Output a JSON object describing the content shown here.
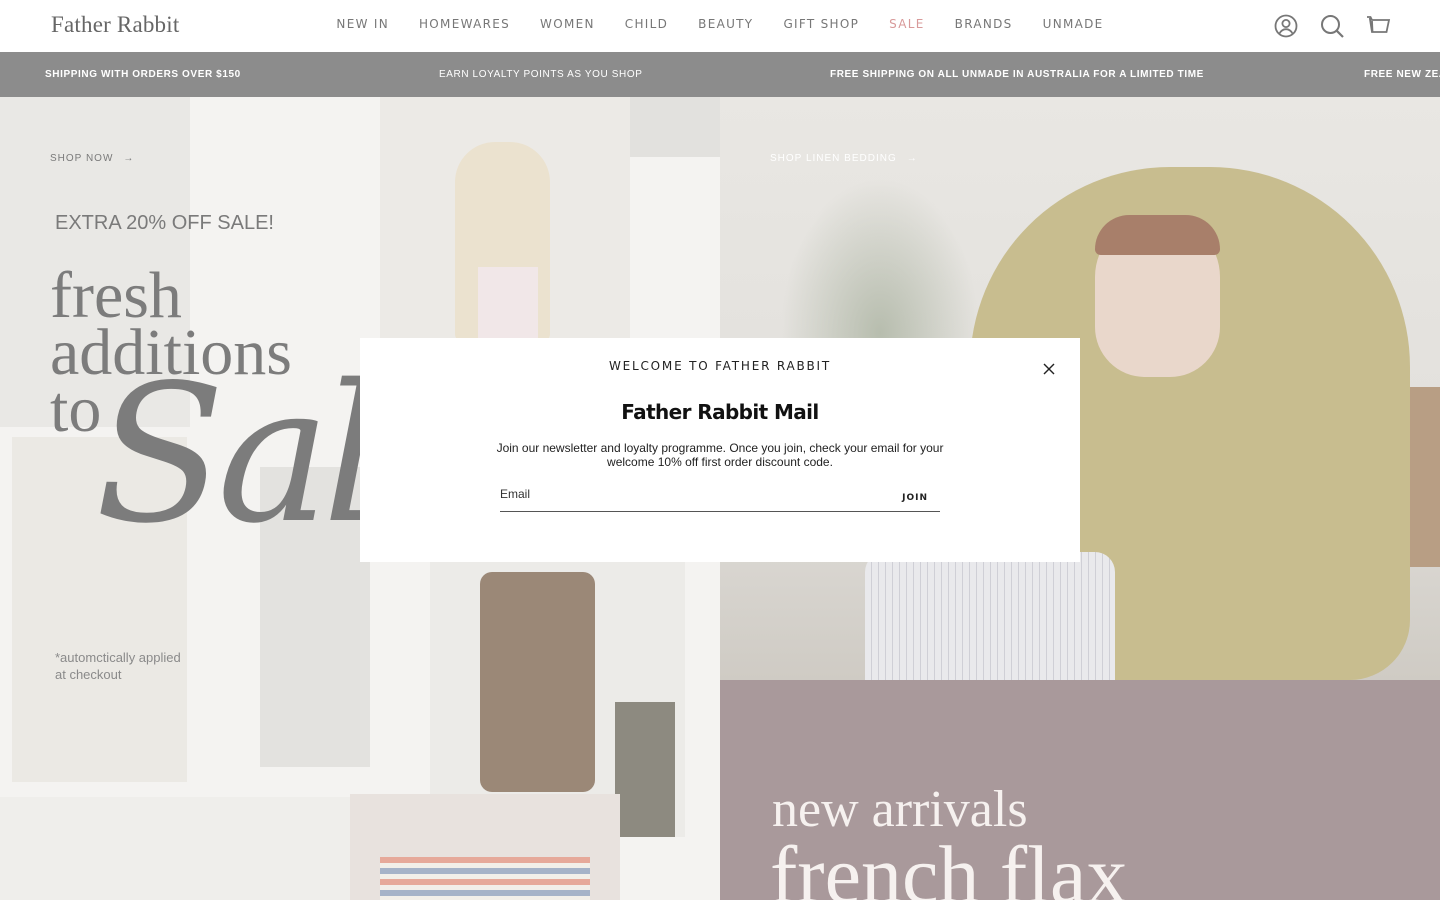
{
  "header": {
    "logo": "Father Rabbit",
    "nav": [
      "NEW IN",
      "HOMEWARES",
      "WOMEN",
      "CHILD",
      "BEAUTY",
      "GIFT SHOP",
      "SALE",
      "BRANDS",
      "UNMADE"
    ],
    "icons": [
      "account-icon",
      "search-icon",
      "cart-icon"
    ]
  },
  "announcements": [
    "SHIPPING WITH ORDERS OVER $150",
    "EARN LOYALTY POINTS AS YOU SHOP",
    "FREE SHIPPING ON ALL UNMADE IN AUSTRALIA FOR A LIMITED TIME",
    "FREE NEW ZEA"
  ],
  "hero_left": {
    "shop_link": "SHOP NOW",
    "extra": "EXTRA 20% OFF SALE!",
    "headline": "fresh\nadditions\nto",
    "sale_word": "Sal",
    "note": "*automctically applied\n at checkout"
  },
  "hero_right": {
    "shop_link": "SHOP LINEN BEDDING"
  },
  "arrivals": {
    "line1": "new arrivals",
    "line2": "french flax"
  },
  "modal": {
    "welcome": "WELCOME TO FATHER RABBIT",
    "title": "Father Rabbit Mail",
    "description": "Join our newsletter and loyalty programme. Once you join, check your email for your welcome 10% off first order discount code.",
    "email_placeholder": "Email",
    "join_label": "JOIN"
  },
  "colors": {
    "sale_nav": "#d89a9a",
    "announcement_bg": "#8c8c8c",
    "arrivals_bg": "#a9999b"
  }
}
